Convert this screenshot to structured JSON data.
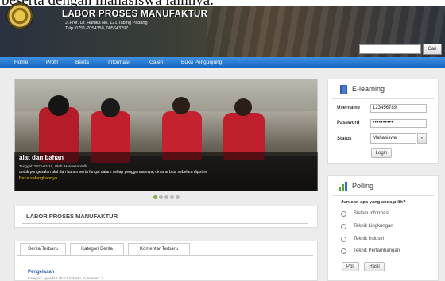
{
  "document_text": "beserta dengan mahasiswa lainnya.",
  "header": {
    "title": "LABOR PROSES MANUFAKTUR",
    "address": "Jl.Prof. Dr. Hamka No. 121 Tabing Padang",
    "phone": "Telp: 0751-7054350, 085643297",
    "search_placeholder": "",
    "search_button": "Cari"
  },
  "nav": {
    "items": [
      "Home",
      "Profil",
      "Berita",
      "Informasi",
      "Galeri",
      "Buku Pengunjung"
    ]
  },
  "slider": {
    "title": "alat dan bahan",
    "meta": "Tanggal: 2017-02-16, Oleh: Harwasa Yulfa",
    "description": "untuk pengenalan alat dan bahan serta fungsi dalam setiap penggunaannya, dimana besi sebelum dipoton",
    "link": "Baca selengkapnya...",
    "dots_total": 5,
    "active_dot": 1
  },
  "section": {
    "title": "LABOR PROSES MANUFAKTUR"
  },
  "tabs": {
    "items": [
      "Berita Terbaru",
      "Kategori Berita",
      "Komentar Terbaru"
    ],
    "post_title": "Pengelasan",
    "post_meta": "Kategori: Agenda Labor T.Industri, Komentar : 2"
  },
  "elearning": {
    "title": "E-learning",
    "username_label": "Username",
    "username_value": "123456789",
    "password_label": "Password",
    "password_value": "••••••••••",
    "status_label": "Status",
    "status_value": "Mahasiswa",
    "login_button": "Login"
  },
  "polling": {
    "title": "Polling",
    "question": "Jurusan apa yang anda pilih?",
    "options": [
      "Sistem Informasi",
      "Teknik Lingkungan",
      "Teknik Industri",
      "Teknik Pertambangan"
    ],
    "poll_button": "Poll",
    "result_button": "Hasil"
  },
  "colors": {
    "nav_blue": "#1f73cf",
    "link_blue": "#2a5db0",
    "active_dot": "#7cb342",
    "caption_link": "#f0c000",
    "polling_chart_green": "#5aa832",
    "polling_chart_blue": "#2f6fd6",
    "elearning_book_blue": "#2f5aa8"
  }
}
